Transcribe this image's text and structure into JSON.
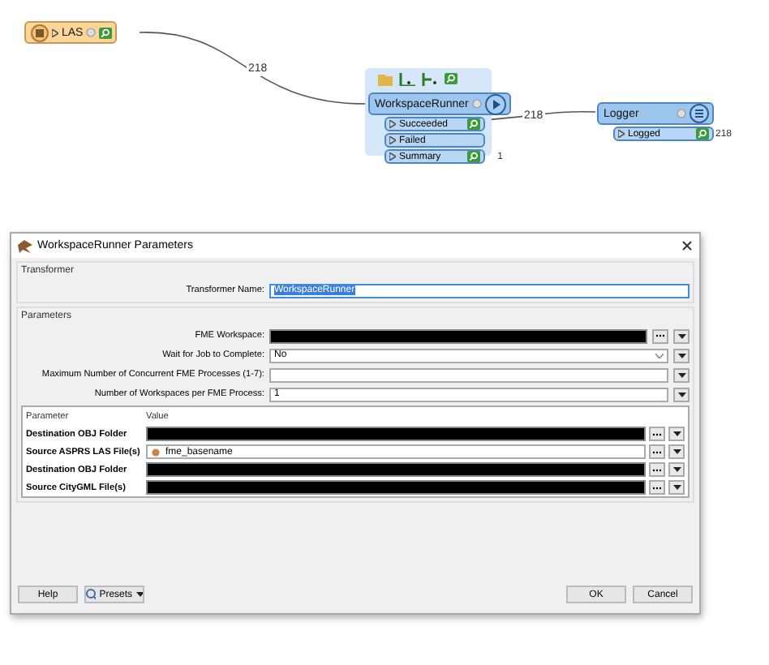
{
  "canvas": {
    "links": [
      {
        "label": "218"
      },
      {
        "label": "218"
      }
    ],
    "nodes": [
      {
        "kind": "reader",
        "name": "LAS"
      },
      {
        "kind": "runner",
        "name": "WorkspaceRunner",
        "ports": [
          {
            "name": "Succeeded",
            "inspect": true
          },
          {
            "name": "Failed",
            "inspect": false
          },
          {
            "name": "Summary",
            "inspect": true,
            "count": "1"
          }
        ]
      },
      {
        "kind": "logger",
        "name": "Logger",
        "ports": [
          {
            "name": "Logged",
            "inspect": true,
            "count": "218"
          }
        ]
      }
    ]
  },
  "dialog": {
    "title": "WorkspaceRunner Parameters",
    "transformer": {
      "heading": "Transformer",
      "label": "Transformer Name:",
      "value": "WorkspaceRunner",
      "selected": true
    },
    "parameters": {
      "heading": "Parameters",
      "rows": [
        {
          "label": "FME Workspace:",
          "kind": "redacted"
        },
        {
          "label": "Wait for Job to Complete:",
          "kind": "select",
          "value": "No"
        },
        {
          "label": "Maximum Number of Concurrent FME Processes (1-7):",
          "kind": "text"
        },
        {
          "label": "Number of Workspaces per FME Process:",
          "kind": "text",
          "value": "1"
        }
      ]
    },
    "table": {
      "columns": [
        "Parameter",
        "Value"
      ],
      "rows": [
        {
          "name": "Destination OBJ Folder",
          "kind": "redacted"
        },
        {
          "name": "Source ASPRS LAS File(s)",
          "kind": "attribute",
          "value": "fme_basename"
        },
        {
          "name": "Destination OBJ Folder",
          "kind": "redacted"
        },
        {
          "name": "Source CityGML File(s)",
          "kind": "redacted"
        }
      ]
    },
    "buttons": [
      {
        "label": "Help",
        "kind": "plain"
      },
      {
        "label": "Presets",
        "kind": "menu"
      },
      {
        "label": "OK",
        "kind": "plain"
      },
      {
        "label": "Cancel",
        "kind": "plain"
      }
    ]
  }
}
